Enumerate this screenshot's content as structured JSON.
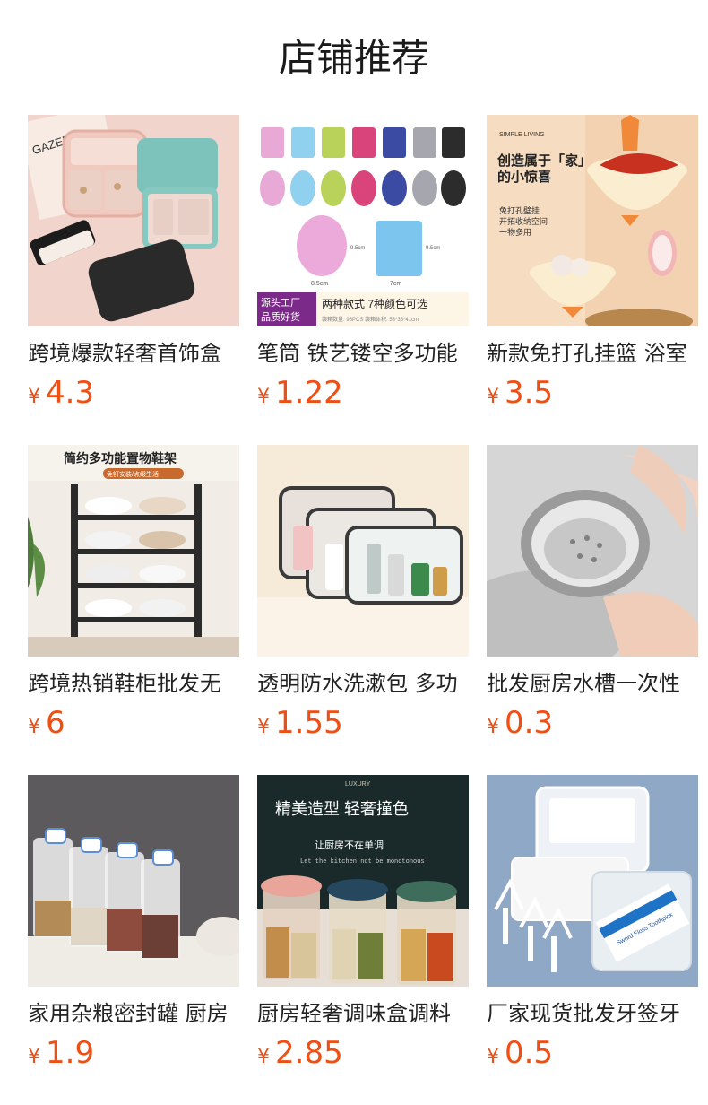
{
  "page": {
    "title": "店铺推荐"
  },
  "currency_symbol": "¥",
  "products": [
    {
      "name": "跨境爆款轻奢首饰盒",
      "price": "4.3",
      "image_text": [
        "GAZEE"
      ]
    },
    {
      "name": "笔筒 铁艺镂空多功能",
      "price": "1.22",
      "image_text": [
        "源头工厂",
        "品质好货",
        "两种款式 7种颜色可选",
        "装箱数量: 96PCS  装箱体积: 53*36*41cm",
        "8.5cm",
        "9.5cm",
        "7cm",
        "9.5cm"
      ]
    },
    {
      "name": "新款免打孔挂篮 浴室",
      "price": "3.5",
      "image_text": [
        "SIMPLE LIVING",
        "创造属于「家」",
        "的小惊喜",
        "免打孔壁挂",
        "开拓收纳空间",
        "一物多用"
      ]
    },
    {
      "name": "跨境热销鞋柜批发无",
      "price": "6",
      "image_text": [
        "简约多功能置物鞋架",
        "免钉安装/点缀生活"
      ]
    },
    {
      "name": "透明防水洗漱包 多功",
      "price": "1.55",
      "image_text": []
    },
    {
      "name": "批发厨房水槽一次性",
      "price": "0.3",
      "image_text": []
    },
    {
      "name": "家用杂粮密封罐 厨房",
      "price": "1.9",
      "image_text": []
    },
    {
      "name": "厨房轻奢调味盒调料",
      "price": "2.85",
      "image_text": [
        "LUXURY",
        "精美造型 轻奢撞色",
        "让厨房不在单调",
        "Let the kitchen not be monotonous"
      ]
    },
    {
      "name": "厂家现货批发牙签牙",
      "price": "0.5",
      "image_text": [
        "Sword Floss Toothpick"
      ]
    }
  ]
}
